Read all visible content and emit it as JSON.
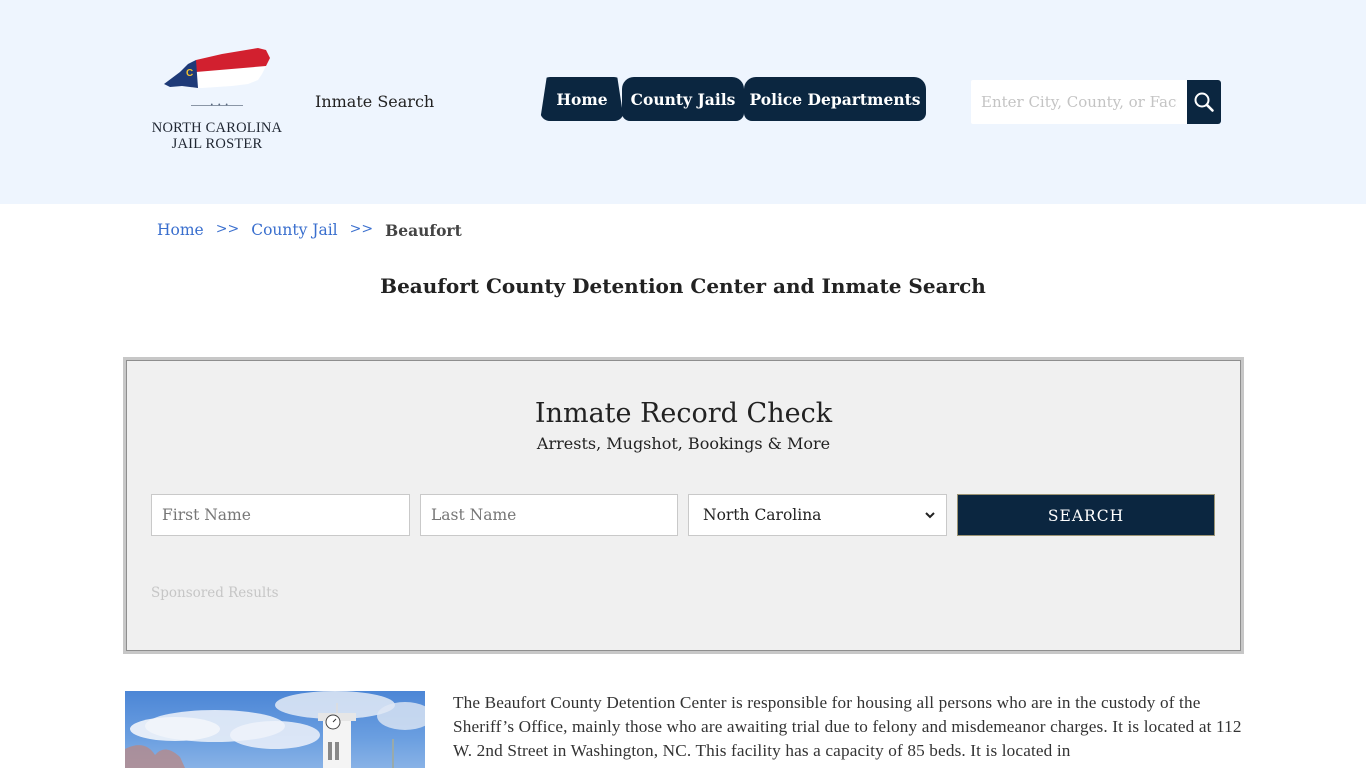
{
  "header": {
    "logo": {
      "line1": "NORTH CAROLINA",
      "line2": "JAIL ROSTER",
      "dots": "• • •",
      "colors": {
        "blue": "#1e3a78",
        "red": "#d2202f",
        "gold": "#f2c12e"
      }
    },
    "inmate_search_link": "Inmate Search",
    "nav": [
      {
        "label": "Home"
      },
      {
        "label": "County Jails"
      },
      {
        "label": "Police Departments"
      }
    ],
    "search": {
      "placeholder": "Enter City, County, or Facility",
      "value": "",
      "icon": "search-icon"
    }
  },
  "breadcrumb": {
    "items": [
      {
        "label": "Home"
      },
      {
        "label": "County Jail"
      }
    ],
    "separator": ">>",
    "current": "Beaufort"
  },
  "page_title": "Beaufort County Detention Center and Inmate Search",
  "record_check": {
    "title": "Inmate Record Check",
    "subtitle": "Arrests, Mugshot, Bookings & More",
    "first_name": {
      "placeholder": "First Name",
      "value": ""
    },
    "last_name": {
      "placeholder": "Last Name",
      "value": ""
    },
    "state_select": {
      "selected": "North Carolina"
    },
    "search_label": "SEARCH",
    "sponsored_label": "Sponsored Results"
  },
  "article": {
    "image_alt": "Beaufort County courthouse clock tower",
    "text": "The Beaufort County Detention Center is responsible for housing all persons who are in the custody of the Sheriff’s Office, mainly those who are awaiting trial due to felony and misdemeanor charges. It is located at 112 W. 2nd Street in Washington, NC. This facility has a capacity of 85 beds. It is located in"
  },
  "colors": {
    "header_bg": "#eef5fe",
    "navy": "#0b2640",
    "link_blue": "#3a6fce",
    "panel_bg": "#f0f0f0"
  }
}
